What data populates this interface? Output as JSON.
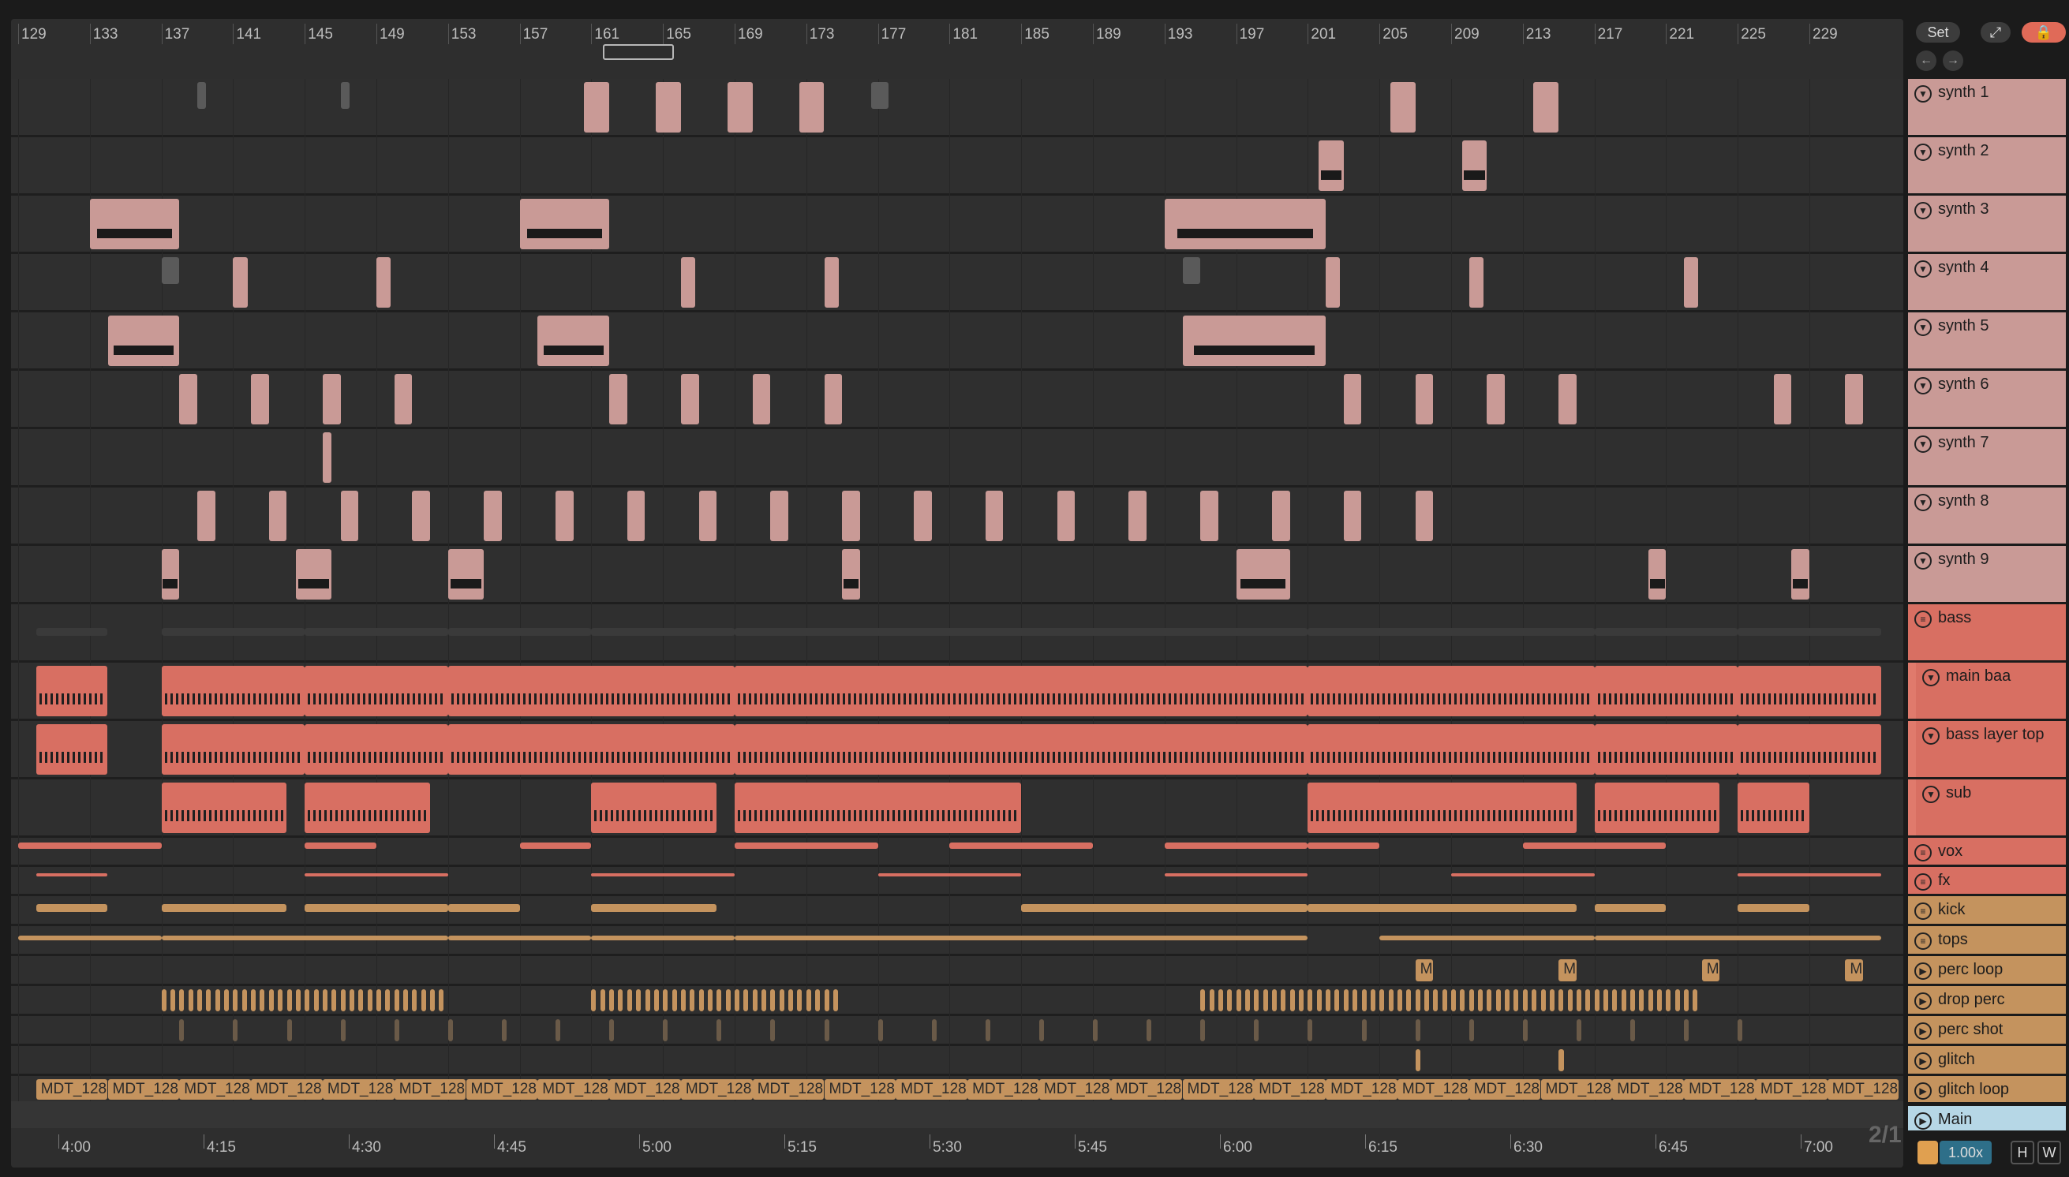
{
  "bar_numbers": [
    "129",
    "133",
    "137",
    "141",
    "145",
    "149",
    "153",
    "157",
    "161",
    "165",
    "169",
    "173",
    "177",
    "181",
    "185",
    "189",
    "193",
    "197",
    "201",
    "205",
    "209",
    "213",
    "217",
    "221",
    "225",
    "229"
  ],
  "time_labels": [
    "4:00",
    "4:15",
    "4:30",
    "4:45",
    "5:00",
    "5:15",
    "5:30",
    "5:45",
    "6:00",
    "6:15",
    "6:30",
    "6:45",
    "7:00"
  ],
  "controls": {
    "set_label": "Set",
    "expand_icon": "expand-icon",
    "lock_icon": "lock-icon",
    "back_icon": "arrow-left-icon",
    "forward_icon": "arrow-right-icon",
    "zoom": "1.00x",
    "h_label": "H",
    "w_label": "W",
    "ratio": "2/1"
  },
  "tracks": [
    {
      "name": "synth 1",
      "color": "#c99a96",
      "kind": "midi"
    },
    {
      "name": "synth 2",
      "color": "#c99a96",
      "kind": "midi"
    },
    {
      "name": "synth 3",
      "color": "#c99a96",
      "kind": "midi"
    },
    {
      "name": "synth 4",
      "color": "#c99a96",
      "kind": "midi"
    },
    {
      "name": "synth 5",
      "color": "#c99a96",
      "kind": "midi"
    },
    {
      "name": "synth 6",
      "color": "#c99a96",
      "kind": "midi"
    },
    {
      "name": "synth 7",
      "color": "#c99a96",
      "kind": "midi"
    },
    {
      "name": "synth 8",
      "color": "#c99a96",
      "kind": "midi"
    },
    {
      "name": "synth 9",
      "color": "#c99a96",
      "kind": "midi"
    },
    {
      "name": "bass",
      "color": "#d86f62",
      "kind": "group"
    },
    {
      "name": "main baa",
      "color": "#d86f62",
      "kind": "sub"
    },
    {
      "name": "bass layer top",
      "color": "#d86f62",
      "kind": "sub"
    },
    {
      "name": "sub",
      "color": "#d86f62",
      "kind": "sub"
    },
    {
      "name": "vox",
      "color": "#d86f62",
      "kind": "group"
    },
    {
      "name": "fx",
      "color": "#d86f62",
      "kind": "group"
    },
    {
      "name": "kick",
      "color": "#c4935e",
      "kind": "group"
    },
    {
      "name": "tops",
      "color": "#c4935e",
      "kind": "group"
    },
    {
      "name": "perc loop",
      "color": "#c4935e",
      "kind": "audio"
    },
    {
      "name": "drop perc",
      "color": "#c4935e",
      "kind": "audio"
    },
    {
      "name": "perc shot",
      "color": "#c4935e",
      "kind": "audio"
    },
    {
      "name": "glitch",
      "color": "#c4935e",
      "kind": "audio"
    },
    {
      "name": "glitch loop",
      "color": "#c4935e",
      "kind": "audio"
    },
    {
      "name": "Main",
      "color": "#b6d7e6",
      "kind": "main"
    }
  ],
  "clip_label": "MDT_128",
  "perc_clip_label": "M"
}
